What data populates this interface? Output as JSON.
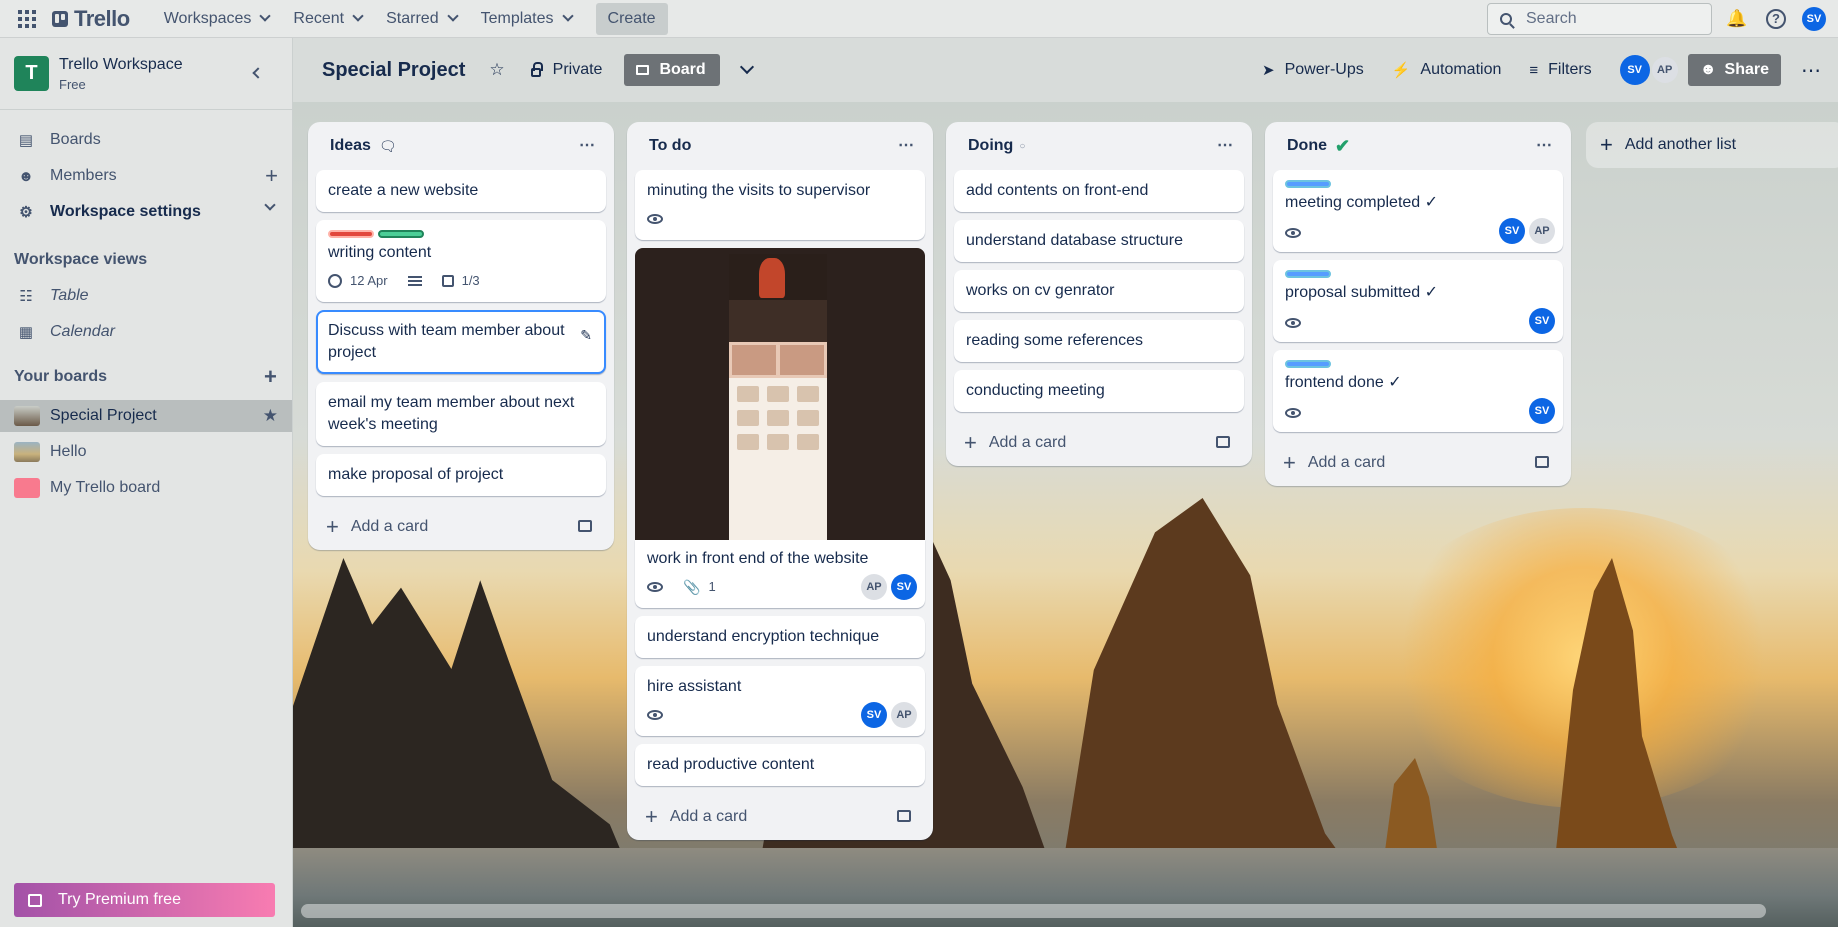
{
  "topnav": {
    "logo": "Trello",
    "menus": [
      "Workspaces",
      "Recent",
      "Starred",
      "Templates"
    ],
    "create": "Create",
    "search_placeholder": "Search",
    "user_initials": "SV"
  },
  "sidebar": {
    "workspace_initial": "T",
    "workspace_name": "Trello Workspace",
    "plan": "Free",
    "items": [
      {
        "label": "Boards",
        "icon": "trello-icon"
      },
      {
        "label": "Members",
        "icon": "person-icon"
      },
      {
        "label": "Workspace settings",
        "icon": "gear-icon"
      }
    ],
    "views_heading": "Workspace views",
    "views": [
      {
        "label": "Table",
        "icon": "table-icon"
      },
      {
        "label": "Calendar",
        "icon": "calendar-icon"
      }
    ],
    "boards_heading": "Your boards",
    "boards": [
      {
        "label": "Special Project",
        "active": true
      },
      {
        "label": "Hello",
        "active": false
      },
      {
        "label": "My Trello board",
        "active": false
      }
    ],
    "premium": "Try Premium free"
  },
  "board": {
    "title": "Special Project",
    "visibility": "Private",
    "view": "Board",
    "powerups": "Power-Ups",
    "automation": "Automation",
    "filters": "Filters",
    "members": [
      "SV",
      "AP"
    ],
    "share": "Share",
    "add_list": "Add another list",
    "add_card": "Add a card"
  },
  "lists": {
    "ideas": {
      "title": "Ideas",
      "cards": [
        "create a new website",
        "writing content",
        "Discuss with team member about project",
        "email my team member about next week's meeting",
        "make proposal of project"
      ],
      "writing_due": "12 Apr",
      "writing_checklist": "1/3"
    },
    "todo": {
      "title": "To do",
      "cards": [
        "minuting the visits to supervisor",
        "work in front end of the website",
        "understand encryption technique",
        "hire assistant",
        "read productive content"
      ],
      "attachments": "1",
      "front_members": [
        "AP",
        "SV"
      ],
      "hire_members": [
        "SV",
        "AP"
      ]
    },
    "doing": {
      "title": "Doing",
      "cards": [
        "add contents on front-end",
        "understand database structure",
        "works on cv genrator",
        "reading some references",
        "conducting meeting"
      ]
    },
    "done": {
      "title": "Done",
      "cards": [
        "meeting completed ✓",
        "proposal submitted ✓",
        "frontend done ✓"
      ],
      "meeting_members": [
        "SV",
        "AP"
      ],
      "proposal_members": [
        "SV"
      ],
      "frontend_members": [
        "SV"
      ]
    }
  },
  "colors": {
    "accent": "#0c66e4",
    "workspace_tile": "#1f845a",
    "label_red": "#e2483d",
    "label_green": "#4bce97",
    "label_blue": "#579dff",
    "done_check": "#22a06b"
  }
}
